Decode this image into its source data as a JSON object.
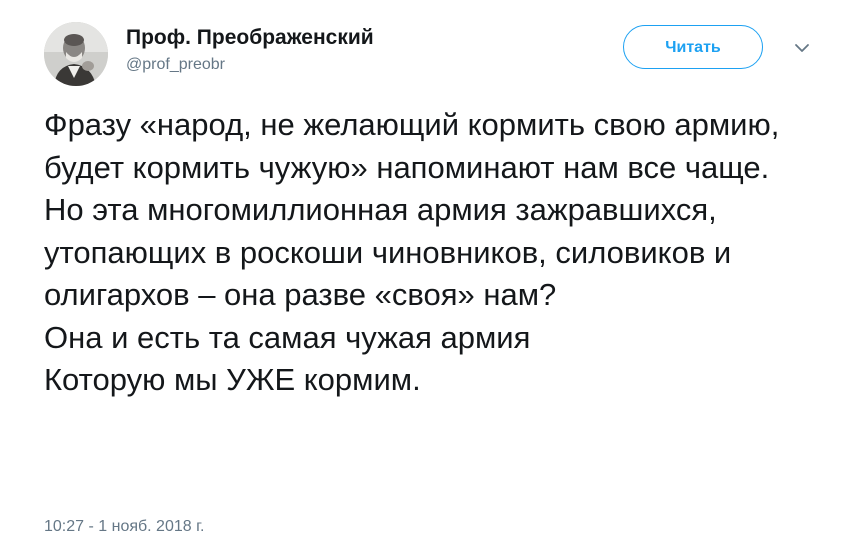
{
  "author": {
    "display_name": "Проф. Преображенский",
    "handle": "@prof_preobr",
    "avatar_icon": "avatar-portrait-photo"
  },
  "actions": {
    "follow_label": "Читать",
    "menu_icon": "chevron-down-icon"
  },
  "tweet": {
    "text": "Фразу «народ, не желающий кормить свою армию, будет кормить чужую» напоминают нам все чаще.\nНо эта многомиллионная армия зажравшихся, утопающих в роскоши чиновников, силовиков и олигархов – она разве «своя» нам?\nОна и есть та самая чужая армия\nКоторую мы УЖЕ кормим.",
    "timestamp": "10:27 - 1 нояб. 2018 г."
  },
  "colors": {
    "accent": "#1da1f2",
    "text_primary": "#14171a",
    "text_secondary": "#657786"
  }
}
